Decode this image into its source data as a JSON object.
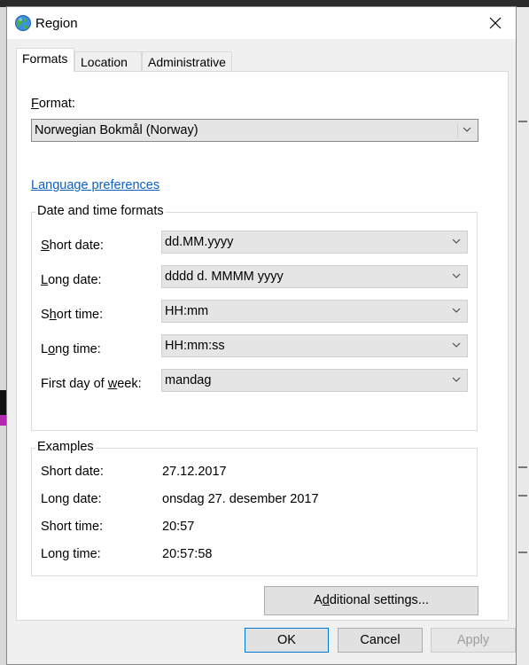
{
  "window": {
    "title": "Region",
    "icon": "globe-icon",
    "close_icon": "close-icon"
  },
  "tabs": [
    {
      "label": "Formats",
      "active": true
    },
    {
      "label": "Location",
      "active": false
    },
    {
      "label": "Administrative",
      "active": false
    }
  ],
  "format": {
    "label_prefix": "F",
    "label_rest": "ormat:",
    "value": "Norwegian Bokmål (Norway)"
  },
  "language_link": "Language preferences",
  "date_time_formats": {
    "group_title": "Date and time formats",
    "rows": [
      {
        "label_pre": "",
        "label_ul": "S",
        "label_post": "hort date:",
        "value": "dd.MM.yyyy"
      },
      {
        "label_pre": "",
        "label_ul": "L",
        "label_post": "ong date:",
        "value": "dddd d. MMMM yyyy"
      },
      {
        "label_pre": "S",
        "label_ul": "h",
        "label_post": "ort time:",
        "value": "HH:mm"
      },
      {
        "label_pre": "L",
        "label_ul": "o",
        "label_post": "ng time:",
        "value": "HH:mm:ss"
      },
      {
        "label_pre": "First day of ",
        "label_ul": "w",
        "label_post": "eek:",
        "value": "mandag"
      }
    ]
  },
  "examples": {
    "group_title": "Examples",
    "rows": [
      {
        "label": "Short date:",
        "value": "27.12.2017"
      },
      {
        "label": "Long date:",
        "value": "onsdag 27. desember 2017"
      },
      {
        "label": "Short time:",
        "value": "20:57"
      },
      {
        "label": "Long time:",
        "value": "20:57:58"
      }
    ]
  },
  "buttons": {
    "additional_pre": "A",
    "additional_ul": "d",
    "additional_post": "ditional settings...",
    "ok": "OK",
    "cancel": "Cancel",
    "apply": "Apply"
  },
  "colors": {
    "link": "#0b61c2",
    "default_button_border": "#0078d7",
    "disabled_text": "#9d9d9d"
  }
}
